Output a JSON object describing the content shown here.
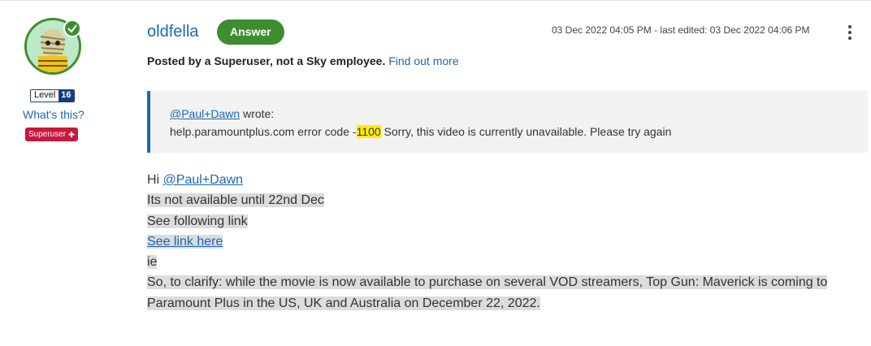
{
  "author": {
    "name": "oldfella",
    "level_label": "Level",
    "level_number": "16",
    "whats_this": "What's this?",
    "role": "Superuser",
    "role_icon": "plus-icon"
  },
  "post": {
    "badge": "Answer",
    "timestamp": "03 Dec 2022 04:05 PM - last edited: 03 Dec 2022 04:06 PM",
    "notice_bold": "Posted by a Superuser, not a Sky employee.",
    "notice_link": "Find out more"
  },
  "quote": {
    "author_link": "@Paul+Dawn",
    "wrote": " wrote:",
    "text_before": "help.paramountplus.com error code -",
    "highlight": "1100",
    "text_after": " Sorry, this video is currently unavailable. Please try again"
  },
  "body": {
    "greeting": "Hi ",
    "mention": "@Paul+Dawn",
    "line2": "Its not available until 22nd Dec",
    "line3": "See following link",
    "link": "See link here ",
    "line5": "ie",
    "line6": "So, to clarify: while the movie is now available to purchase on several VOD streamers, Top Gun: Maverick is coming to",
    "line7": "Paramount Plus in the US, UK and Australia on December 22, 2022."
  },
  "colors": {
    "brand_blue": "#1c67b5",
    "answer_green": "#3e8e2f",
    "superuser_red": "#c8193b",
    "highlight_yellow": "#ffee00"
  }
}
